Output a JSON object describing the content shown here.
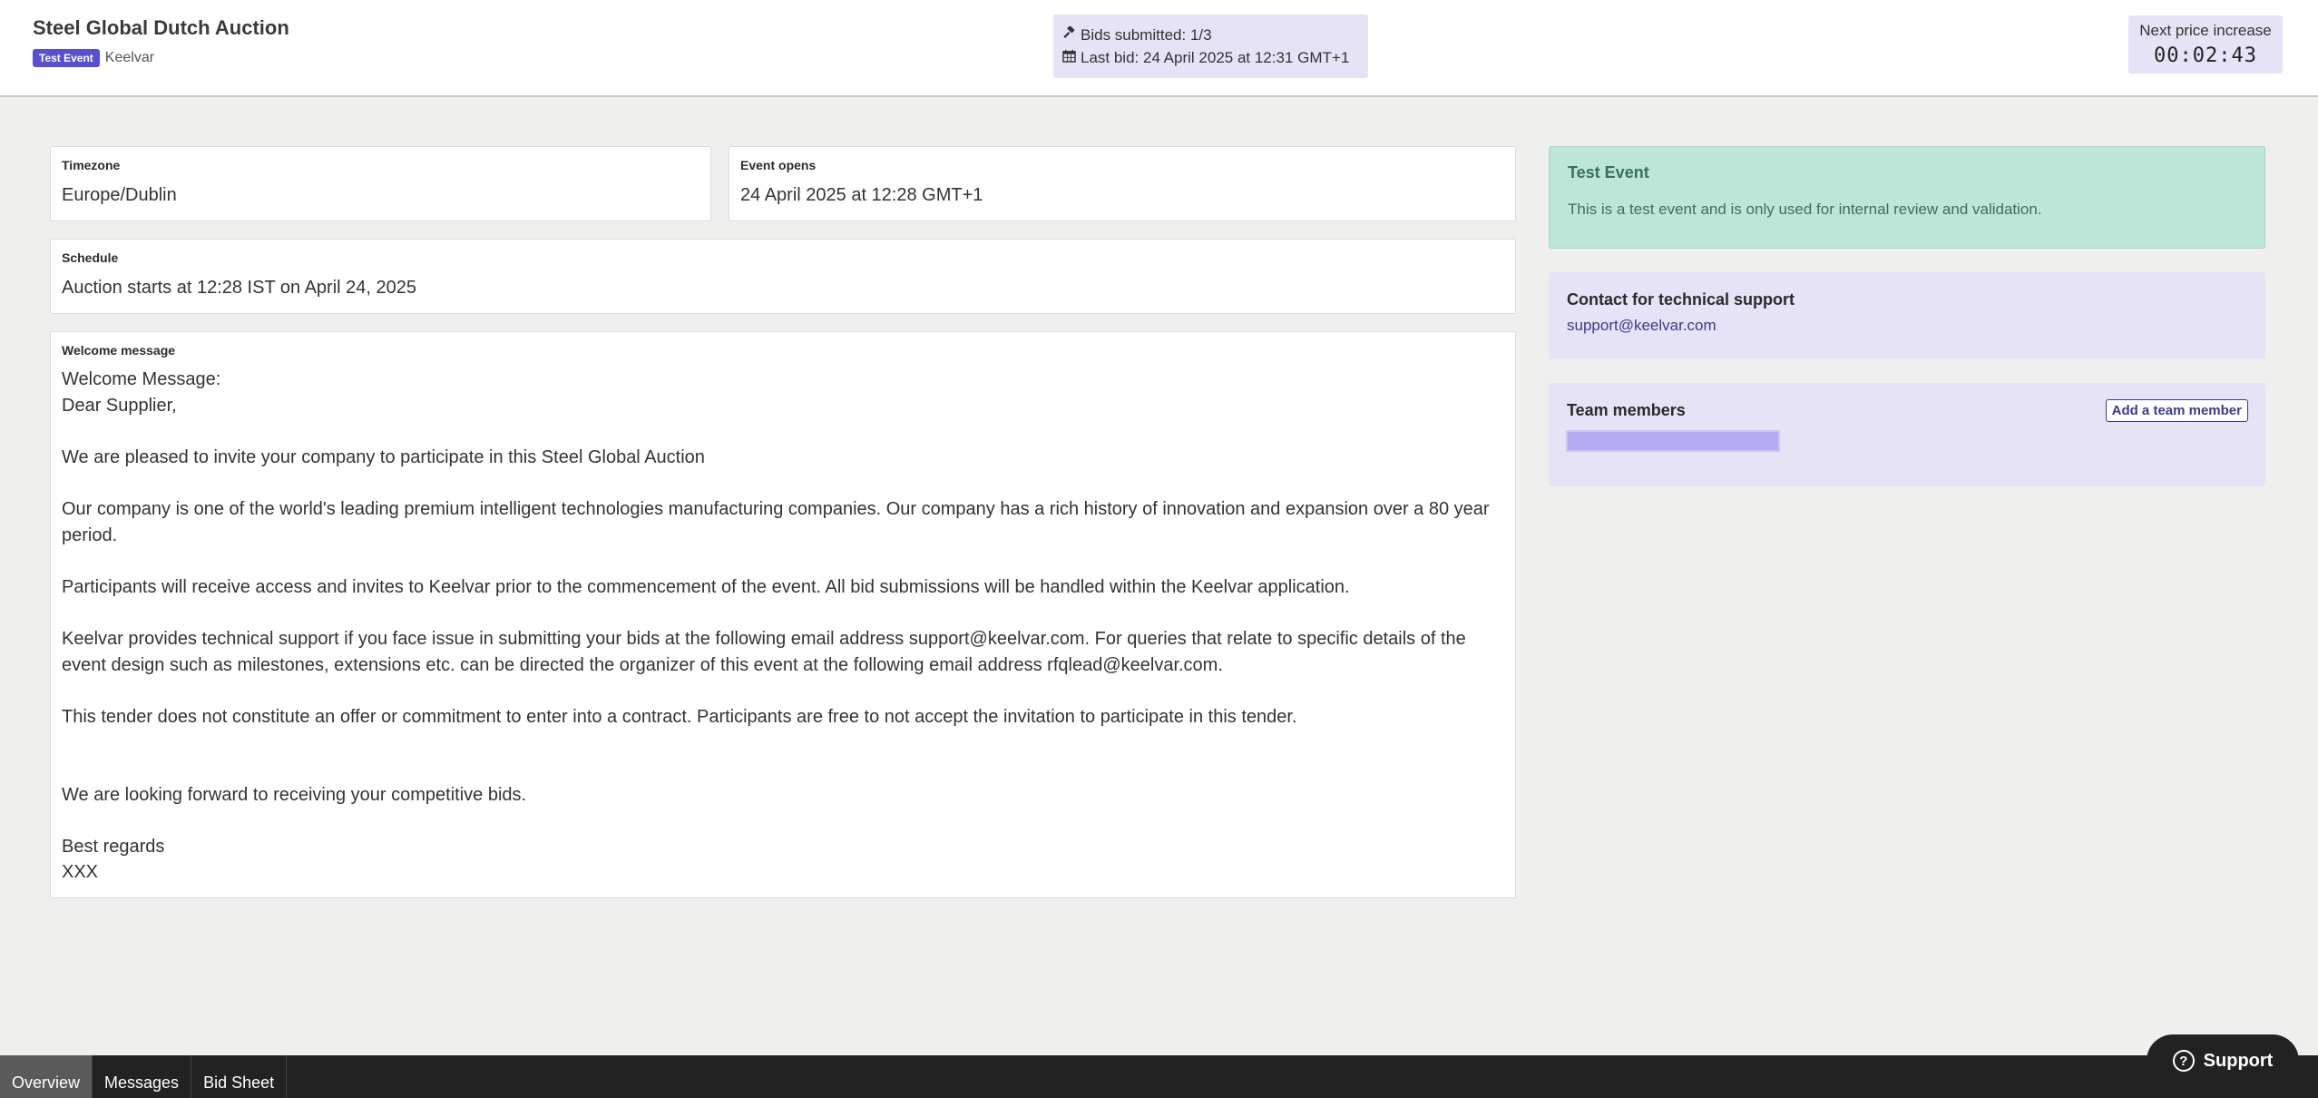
{
  "header": {
    "title": "Steel Global Dutch Auction",
    "badge": "Test Event",
    "organization": "Keelvar",
    "bids_submitted": "Bids submitted: 1/3",
    "last_bid": "Last bid: 24 April 2025 at 12:31 GMT+1",
    "timer_label": "Next price increase",
    "timer_value": "00:02:43"
  },
  "details": {
    "timezone_label": "Timezone",
    "timezone_value": "Europe/Dublin",
    "event_opens_label": "Event opens",
    "event_opens_value": "24 April 2025 at 12:28 GMT+1",
    "schedule_label": "Schedule",
    "schedule_value": "Auction starts at 12:28 IST on April 24, 2025",
    "welcome_label": "Welcome message",
    "welcome_lines": [
      "Welcome Message:",
      "Dear Supplier,",
      "",
      "We are pleased to invite your company to participate in this Steel Global Auction",
      "",
      "Our company is one of the world's leading premium intelligent technologies manufacturing companies. Our company has a rich history of innovation and expansion over a 80 year period.",
      "",
      "Participants will receive access and invites to Keelvar prior to the commencement of the event. All bid submissions will be handled within the Keelvar application.",
      "",
      "Keelvar provides technical support if you face issue in submitting your bids at the following email address support@keelvar.com. For queries that relate to specific details of the event design such as milestones, extensions etc. can be directed the organizer of this event at the following email address rfqlead@keelvar.com.",
      "",
      "This tender does not constitute an offer or commitment to enter into a contract. Participants are free to not accept the invitation to participate in this tender.",
      "",
      "",
      "We are looking forward to receiving your competitive bids.",
      "",
      "Best regards",
      "XXX"
    ]
  },
  "sidebar": {
    "test_event_title": "Test Event",
    "test_event_text": "This is a test event and is only used for internal review and validation.",
    "support_title": "Contact for technical support",
    "support_email": "support@keelvar.com",
    "team_title": "Team members",
    "add_member_label": "Add a team member"
  },
  "tabs": [
    "Overview",
    "Messages",
    "Bid Sheet"
  ],
  "support_button": "Support",
  "colors": {
    "accent": "#5a4fcf",
    "panel_purple": "#e5e3f5",
    "panel_green": "#bde6d9",
    "bottom_bar": "#222222"
  }
}
